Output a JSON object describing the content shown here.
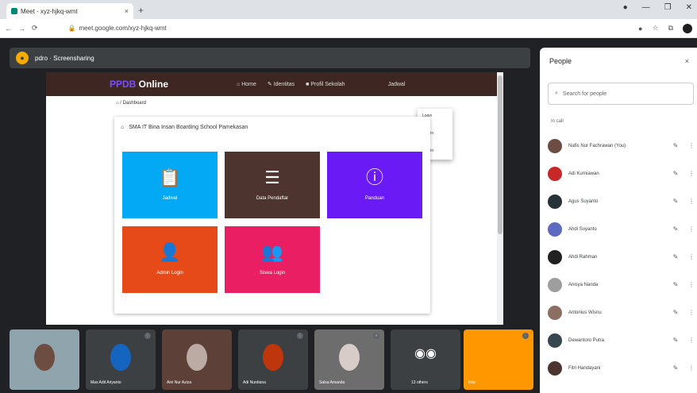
{
  "browser": {
    "tab_title": "Meet - xyz-hjkq-wmt",
    "tab_close": "×",
    "new_tab": "+",
    "controls": [
      "●",
      "—",
      "❐",
      "✕"
    ],
    "url": "meet.google.com/xyz-hjkq-wmt",
    "nav": [
      "←",
      "→",
      "⟳"
    ]
  },
  "meeting": {
    "code": "pdro · Screensharing"
  },
  "site": {
    "brand_prefix": "PPDB",
    "brand_suffix": " Online",
    "nav_items": [
      "Home",
      "Identitas",
      "Profil Sekolah",
      "Jadwal"
    ],
    "dropdown_items": [
      "Login",
      "Admin",
      "Admin"
    ],
    "breadcrumb": "⌂ / Dashboard",
    "card_title": "SMA IT Bina Insan Boarding School Pamekasan",
    "tiles": [
      {
        "label": "Jadwal",
        "icon": "📋"
      },
      {
        "label": "Data Pendaftar",
        "icon": "☰"
      },
      {
        "label": "Panduan",
        "icon": "ⓘ"
      },
      {
        "label": "Admin Login",
        "icon": "👤"
      },
      {
        "label": "Siswa Login",
        "icon": "👥"
      }
    ]
  },
  "people": {
    "title": "People",
    "close": "×",
    "search_placeholder": "Search for people",
    "section": "In call",
    "list": [
      {
        "name": "Nafis Nur Fachrawan (You)",
        "color": "#6d4c41"
      },
      {
        "name": "Adi Kurniawan",
        "color": "#c62828"
      },
      {
        "name": "Agus Suyanto",
        "color": "#263238"
      },
      {
        "name": "Ahdi Suyanto",
        "color": "#5c6bc0"
      },
      {
        "name": "Ahdi Rahman",
        "color": "#212121"
      },
      {
        "name": "Anisya Nanda",
        "color": "#9e9e9e"
      },
      {
        "name": "Antonius Wisnu",
        "color": "#8d6e63"
      },
      {
        "name": "Dewantoro Putra",
        "color": "#37474f"
      },
      {
        "name": "Fitri Handayani",
        "color": "#4e342e"
      }
    ]
  },
  "videos": [
    {
      "name": "",
      "bg": "#90a4ae",
      "face": "#6d4c41"
    },
    {
      "name": "Mas Adit Ariyanto",
      "bg": "#3c4043",
      "face": "#1565c0"
    },
    {
      "name": "Aini Nur Aziza",
      "bg": "#5d4037",
      "face": "#bcaaa4"
    },
    {
      "name": "Adi Nurdiana",
      "bg": "#3c4043",
      "face": "#bf360c"
    },
    {
      "name": "Salsa Amanda",
      "bg": "#6d6d6d",
      "face": "#d7ccc8"
    },
    {
      "name": "13 others",
      "bg": "#3c4043",
      "face": ""
    },
    {
      "name": "Kita",
      "bg": "#ff9800",
      "face": ""
    }
  ]
}
